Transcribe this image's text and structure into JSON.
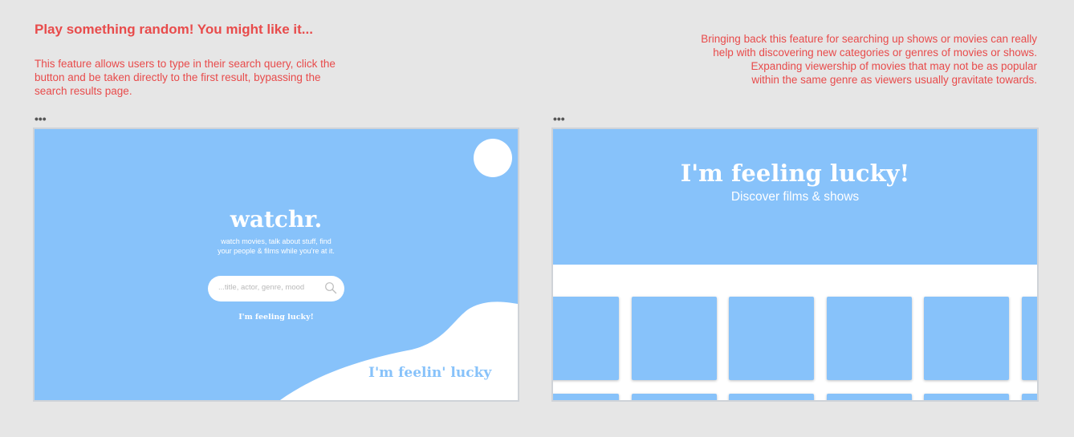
{
  "annotations": {
    "heading": "Play something random! You might like it...",
    "left_description": "This feature allows users to type in their search query, click the button and be taken directly to the first result, bypassing the search results page.",
    "right_description_lines": [
      "Bringing back this feature for searching up shows or movies can really",
      "help with discovering new  categories or genres of movies or shows.",
      "Expanding viewership of movies that may  not be as popular",
      "within the same genre as viewers usually gravitate towards."
    ],
    "frame_menu_label": "•••"
  },
  "home_screen": {
    "logo": "watchr.",
    "tagline": "watch movies, talk about stuff, find your people & films while you're at it.",
    "search_placeholder": "...title, actor, genre, mood",
    "lucky_link": "I'm feeling lucky!",
    "lucky_button": "I'm feelin' lucky",
    "icons": {
      "search": "search-icon",
      "profile": "profile-avatar"
    },
    "colors": {
      "accent": "#87c2fa",
      "surface": "#ffffff",
      "annotation": "#e84b4b"
    }
  },
  "lucky_screen": {
    "title": "I'm feeling lucky!",
    "subtitle": "Discover films & shows"
  }
}
